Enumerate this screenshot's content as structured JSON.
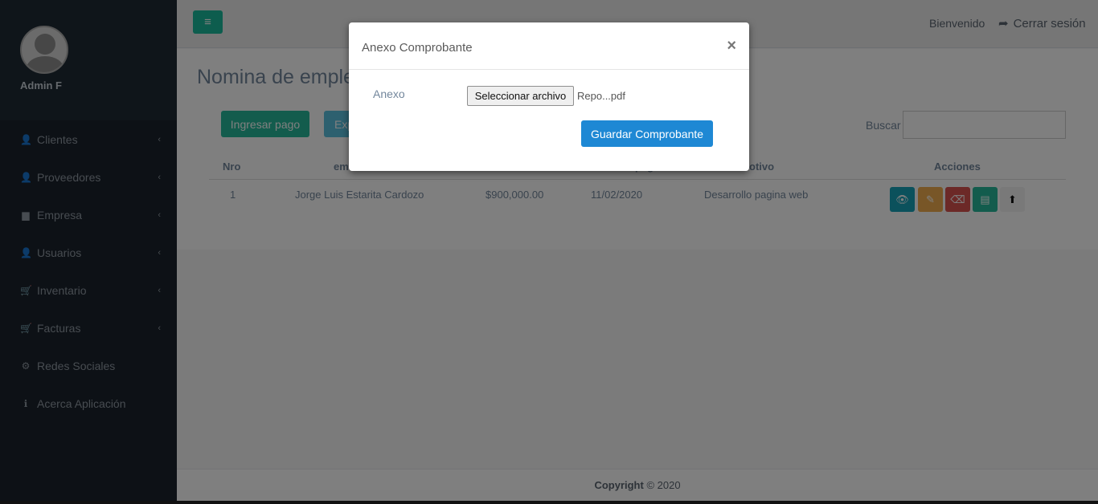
{
  "profile": {
    "name": "Admin F"
  },
  "sidebar": {
    "items": [
      {
        "label": "Clientes",
        "icon": "user-icon",
        "glyph": "👤",
        "chevron": "‹"
      },
      {
        "label": "Proveedores",
        "icon": "user-icon",
        "glyph": "👤",
        "chevron": "‹"
      },
      {
        "label": "Empresa",
        "icon": "building-icon",
        "glyph": "▆",
        "chevron": "‹"
      },
      {
        "label": "Usuarios",
        "icon": "user-icon",
        "glyph": "👤",
        "chevron": "‹"
      },
      {
        "label": "Inventario",
        "icon": "cart-icon",
        "glyph": "🛒",
        "chevron": "‹"
      },
      {
        "label": "Facturas",
        "icon": "cart-icon",
        "glyph": "🛒",
        "chevron": "‹"
      },
      {
        "label": "Redes Sociales",
        "icon": "gear-icon",
        "glyph": "⚙",
        "chevron": ""
      },
      {
        "label": "Acerca Aplicación",
        "icon": "info-icon",
        "glyph": "ℹ",
        "chevron": ""
      }
    ]
  },
  "topnav": {
    "menu_icon": "≡",
    "welcome": "Bienvenido",
    "logout_icon": "➦",
    "logout": "Cerrar sesión"
  },
  "page": {
    "title": "Nomina de emple",
    "btn_pago": "Ingresar pago",
    "btn_export": "Exp",
    "search_label": "Buscar",
    "search_value": ""
  },
  "table": {
    "headers": [
      "Nro",
      "em",
      "",
      "pag",
      "otivo",
      "Acciones"
    ],
    "rows": [
      {
        "nro": "1",
        "empleado": "Jorge Luis Estarita Cardozo",
        "valor": "$900,000.00",
        "fecha": "11/02/2020",
        "motivo": "Desarrollo pagina web"
      }
    ],
    "actions": [
      {
        "name": "view-icon",
        "glyph": "👁",
        "color": "#17a2b8"
      },
      {
        "name": "pencil-icon",
        "glyph": "✎",
        "color": "#f0ad4e"
      },
      {
        "name": "eraser-icon",
        "glyph": "⌫",
        "color": "#d9534f"
      },
      {
        "name": "pdf-icon",
        "glyph": "▤",
        "color": "#26b99a"
      },
      {
        "name": "upload-icon",
        "glyph": "⬆",
        "color": "#f2f2f2"
      }
    ]
  },
  "footer": {
    "copyright_bold": "Copyright",
    "copyright_rest": " © 2020"
  },
  "modal": {
    "title": "Anexo Comprobante",
    "close": "×",
    "label": "Anexo",
    "file_button": "Seleccionar archivo",
    "file_name": "Repo...pdf",
    "save": "Guardar Comprobante"
  },
  "colors": {
    "primary": "#1abb9c",
    "save": "#1e88d4",
    "sidebar": "#1b232c"
  }
}
